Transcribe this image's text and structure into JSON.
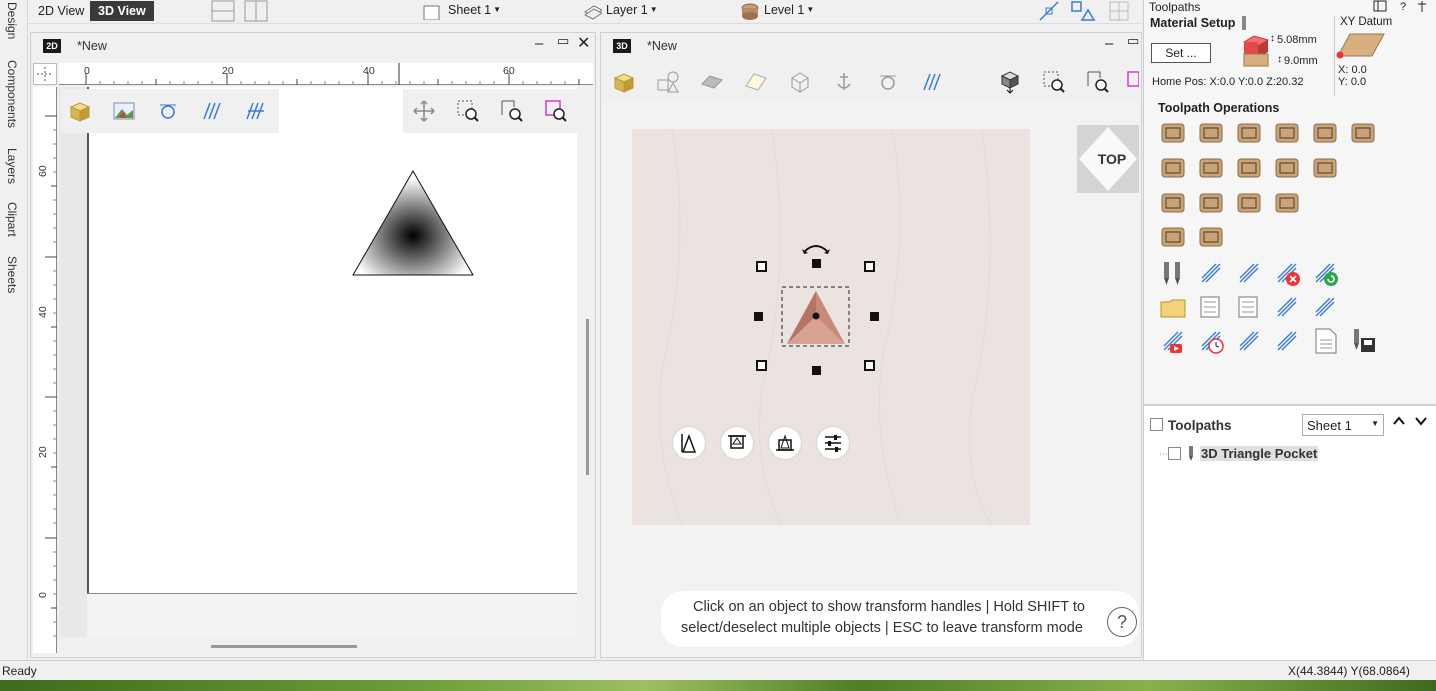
{
  "side_tabs": [
    "Design",
    "Components",
    "Layers",
    "Clipart",
    "Sheets"
  ],
  "topbar": {
    "view_2d": "2D View",
    "view_3d": "3D View",
    "sheet": "Sheet 1",
    "layer": "Layer 1",
    "level": "Level 1"
  },
  "win2d": {
    "badge": "2D",
    "title": "*New",
    "ruler_top": [
      "0",
      "20",
      "40",
      "60"
    ],
    "ruler_left": [
      "60",
      "40",
      "20",
      "0"
    ]
  },
  "win3d": {
    "badge": "3D",
    "title": "*New",
    "view_cube": "TOP",
    "hint_line1": "Click on an object to show transform handles | Hold SHIFT to",
    "hint_line2": "select/deselect multiple objects | ESC to leave transform mode",
    "help": "?"
  },
  "right_panel": {
    "title": "Toolpaths",
    "material_setup": "Material Setup",
    "thickness": "5.08mm",
    "z_offset": "9.0mm",
    "set_button": "Set ...",
    "home_pos": "Home Pos:  X:0.0 Y:0.0 Z:20.32",
    "xy_datum": "XY Datum",
    "datum_x": "X: 0.0",
    "datum_y": "Y: 0.0",
    "toolpath_operations": "Toolpath Operations",
    "toolpaths_label": "Toolpaths",
    "sheet_select": "Sheet 1",
    "toolpath_items": [
      "3D Triangle Pocket"
    ]
  },
  "status": {
    "ready": "Ready",
    "coords": "X(44.3844) Y(68.0864)"
  },
  "colors": {
    "accent": "#3a3a3a",
    "material": "#ebe3e0",
    "pocket": "#c98a7a",
    "icon_wood": "#c9a47a"
  }
}
